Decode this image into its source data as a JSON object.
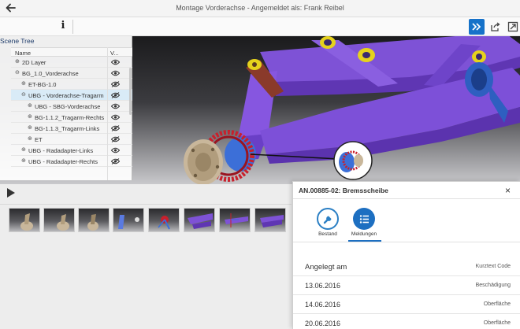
{
  "header": {
    "title": "Montage Vorderachse - Angemeldet als: Frank Reibel"
  },
  "toolbar": {
    "info_icon": "i"
  },
  "scene_tree": {
    "title": "Scene Tree",
    "col_name": "Name",
    "col_vis": "V...",
    "rows": [
      {
        "label": "2D Layer",
        "expander": "⊕",
        "visible": true
      },
      {
        "label": "BG_1.0_Vorderachse",
        "expander": "⊖",
        "visible": true
      },
      {
        "label": "ET-BG-1.0",
        "expander": "⊕",
        "visible": false
      },
      {
        "label": "UBG - Vorderachse-Tragarm",
        "expander": "⊖",
        "visible": false
      },
      {
        "label": "UBG - SBG-Vorderachse",
        "expander": "⊕",
        "visible": true
      },
      {
        "label": "BG-1.1.2_Tragarm-Rechts",
        "expander": "⊕",
        "visible": true
      },
      {
        "label": "BG-1.1.3_Tragarm-Links",
        "expander": "⊕",
        "visible": false
      },
      {
        "label": "ET",
        "expander": "⊕",
        "visible": false
      },
      {
        "label": "UBG - Radadapter-Links",
        "expander": "⊕",
        "visible": true
      },
      {
        "label": "UBG - Radadapter-Rechts",
        "expander": "⊕",
        "visible": false
      }
    ]
  },
  "panel": {
    "title": "AN.00885-02: Bremsscheibe",
    "close": "×",
    "tabs": [
      {
        "label": "Bestand",
        "icon": "wrench-icon"
      },
      {
        "label": "Meldungen",
        "icon": "list-icon"
      }
    ],
    "columns": [
      "Angelegt am",
      "Kurztext Code"
    ],
    "rows": [
      {
        "date": "13.06.2016",
        "code": "Beschädigung"
      },
      {
        "date": "14.06.2016",
        "code": "Oberfläche"
      },
      {
        "date": "20.06.2016",
        "code": "Oberfläche"
      }
    ]
  },
  "colors": {
    "accent": "#1672c9",
    "frame": "#7a4fd1",
    "bolt": "#e6d21c",
    "brake": "#c8202c",
    "hub": "#2e5fc0"
  }
}
